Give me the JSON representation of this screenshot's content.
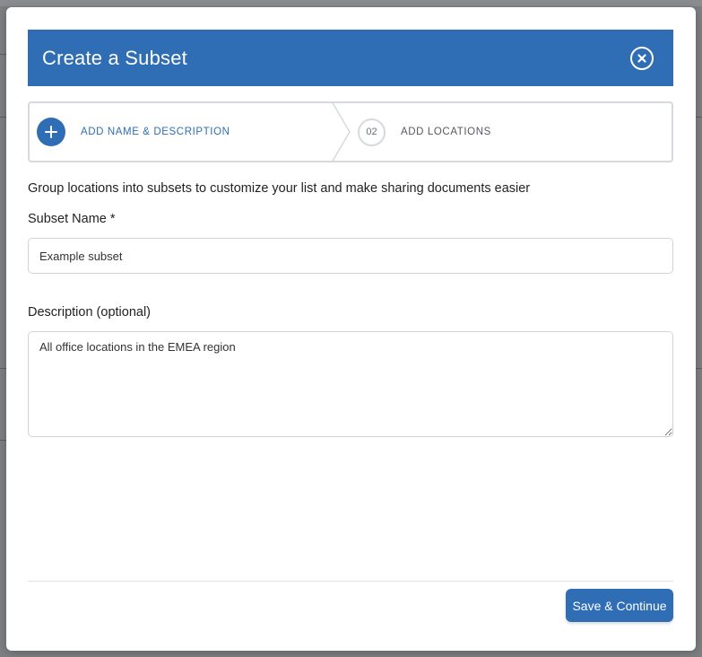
{
  "modal": {
    "title": "Create a Subset",
    "close_icon": "close-circle-icon"
  },
  "stepper": {
    "steps": [
      {
        "marker": "plus-icon",
        "label": "ADD NAME & DESCRIPTION",
        "active": true
      },
      {
        "marker": "02",
        "label": "ADD LOCATIONS",
        "active": false
      }
    ]
  },
  "intro_text": "Group locations into subsets to customize your list and make sharing documents easier",
  "form": {
    "name_label": "Subset Name *",
    "name_value": "Example subset",
    "description_label": "Description (optional)",
    "description_value": "All office locations in the EMEA region"
  },
  "footer": {
    "primary_button": "Save & Continue"
  },
  "colors": {
    "accent": "#2f6eb5",
    "overlay": "#7d7f83"
  }
}
